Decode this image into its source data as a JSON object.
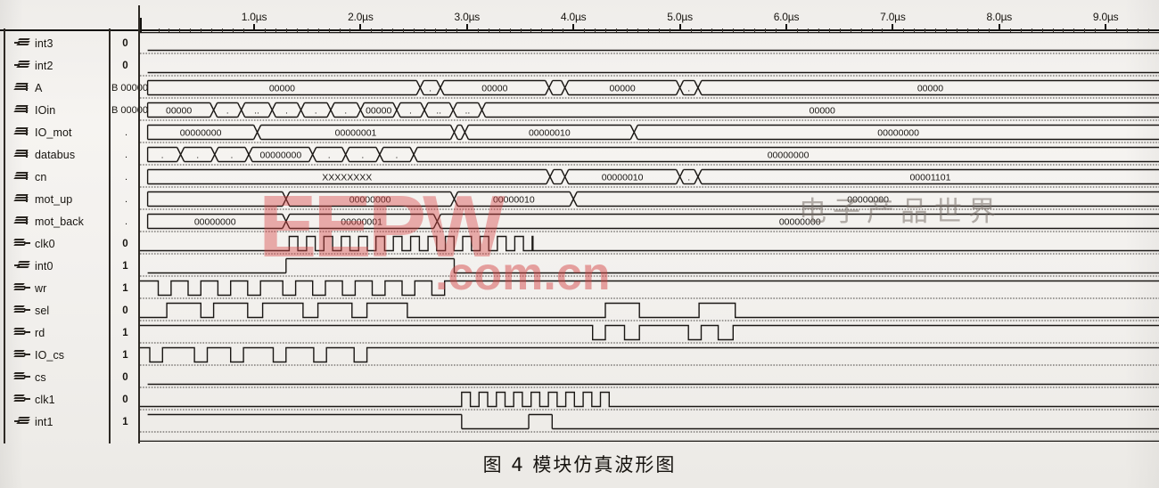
{
  "caption": "图 4  模块仿真波形图",
  "watermark": {
    "brand": "EEPW",
    "domain": ".com.cn",
    "chinese": "电子产品世界",
    "brand_color": "#d64646"
  },
  "ruler": {
    "unit": "µs",
    "ticks": [
      {
        "label": "1.0µs",
        "us": 1.0
      },
      {
        "label": "2.0µs",
        "us": 2.0
      },
      {
        "label": "3.0µs",
        "us": 3.0
      },
      {
        "label": "4.0µs",
        "us": 4.0
      },
      {
        "label": "5.0µs",
        "us": 5.0
      },
      {
        "label": "6.0µs",
        "us": 6.0
      },
      {
        "label": "7.0µs",
        "us": 7.0
      },
      {
        "label": "8.0µs",
        "us": 8.0
      },
      {
        "label": "9.0µs",
        "us": 9.0
      }
    ],
    "range_us": [
      0.0,
      9.58
    ],
    "cursor_us": 0.0
  },
  "signals": [
    {
      "name": "int3",
      "value": "0",
      "icon": "input-signal-icon",
      "kind": "bit"
    },
    {
      "name": "int2",
      "value": "0",
      "icon": "input-signal-icon",
      "kind": "bit"
    },
    {
      "name": "A",
      "value": "B 00000",
      "icon": "bus-signal-icon",
      "kind": "bus"
    },
    {
      "name": "IOin",
      "value": "B 00000",
      "icon": "bus-signal-icon",
      "kind": "bus"
    },
    {
      "name": "IO_mot",
      "value": ".",
      "icon": "bus-signal-icon",
      "kind": "bus"
    },
    {
      "name": "databus",
      "value": ".",
      "icon": "bus-signal-icon",
      "kind": "bus"
    },
    {
      "name": "cn",
      "value": ".",
      "icon": "bus-signal-icon",
      "kind": "bus"
    },
    {
      "name": "mot_up",
      "value": ".",
      "icon": "bus-signal-icon",
      "kind": "bus"
    },
    {
      "name": "mot_back",
      "value": ".",
      "icon": "bus-signal-icon",
      "kind": "bus"
    },
    {
      "name": "clk0",
      "value": "0",
      "icon": "output-signal-icon",
      "kind": "bit"
    },
    {
      "name": "int0",
      "value": "1",
      "icon": "input-signal-icon",
      "kind": "bit"
    },
    {
      "name": "wr",
      "value": "1",
      "icon": "output-signal-icon",
      "kind": "bit"
    },
    {
      "name": "sel",
      "value": "0",
      "icon": "output-signal-icon",
      "kind": "bit"
    },
    {
      "name": "rd",
      "value": "1",
      "icon": "output-signal-icon",
      "kind": "bit"
    },
    {
      "name": "IO_cs",
      "value": "1",
      "icon": "output-signal-icon",
      "kind": "bit"
    },
    {
      "name": "cs",
      "value": "0",
      "icon": "output-signal-icon",
      "kind": "bit"
    },
    {
      "name": "clk1",
      "value": "0",
      "icon": "output-signal-icon",
      "kind": "bit"
    },
    {
      "name": "int1",
      "value": "1",
      "icon": "input-signal-icon",
      "kind": "bit"
    }
  ],
  "chart_data": {
    "type": "timing-diagram",
    "title": "图 4  模块仿真波形图",
    "xlabel": "time",
    "x_unit": "µs",
    "xlim": [
      0.0,
      9.58
    ],
    "grid": false,
    "legend": "none",
    "waveforms": [
      {
        "name": "int3",
        "type": "bit",
        "segments": [
          {
            "from": 0.0,
            "to": 9.58,
            "level": 0
          }
        ]
      },
      {
        "name": "int2",
        "type": "bit",
        "segments": [
          {
            "from": 0.0,
            "to": 9.58,
            "level": 0
          }
        ]
      },
      {
        "name": "A",
        "type": "bus",
        "segments": [
          {
            "from": 0.0,
            "to": 2.56,
            "label": "00000"
          },
          {
            "from": 2.56,
            "to": 2.75,
            "label": "."
          },
          {
            "from": 2.75,
            "to": 3.77,
            "label": "00000"
          },
          {
            "from": 3.77,
            "to": 3.92,
            "label": "."
          },
          {
            "from": 3.92,
            "to": 5.0,
            "label": "00000"
          },
          {
            "from": 5.0,
            "to": 5.17,
            "label": "."
          },
          {
            "from": 5.17,
            "to": 9.58,
            "label": "00000"
          }
        ]
      },
      {
        "name": "IOin",
        "type": "bus",
        "segments": [
          {
            "from": 0.0,
            "to": 0.62,
            "label": "00000"
          },
          {
            "from": 0.62,
            "to": 0.88,
            "label": "."
          },
          {
            "from": 0.88,
            "to": 1.17,
            "label": ".."
          },
          {
            "from": 1.17,
            "to": 1.44,
            "label": "."
          },
          {
            "from": 1.44,
            "to": 1.72,
            "label": "."
          },
          {
            "from": 1.72,
            "to": 2.0,
            "label": "."
          },
          {
            "from": 2.0,
            "to": 2.34,
            "label": "00000"
          },
          {
            "from": 2.34,
            "to": 2.6,
            "label": "."
          },
          {
            "from": 2.6,
            "to": 2.87,
            "label": ".."
          },
          {
            "from": 2.87,
            "to": 3.14,
            "label": ".."
          },
          {
            "from": 3.14,
            "to": 9.58,
            "label": "00000"
          }
        ]
      },
      {
        "name": "IO_mot",
        "type": "bus",
        "segments": [
          {
            "from": 0.0,
            "to": 1.03,
            "label": "00000000"
          },
          {
            "from": 1.03,
            "to": 2.88,
            "label": "00000001"
          },
          {
            "from": 2.88,
            "to": 2.98,
            "label": "."
          },
          {
            "from": 2.98,
            "to": 4.57,
            "label": "00000010"
          },
          {
            "from": 4.57,
            "to": 9.58,
            "label": "00000000"
          }
        ]
      },
      {
        "name": "databus",
        "type": "bus",
        "segments": [
          {
            "from": 0.0,
            "to": 0.31,
            "label": "."
          },
          {
            "from": 0.31,
            "to": 0.63,
            "label": "."
          },
          {
            "from": 0.63,
            "to": 0.95,
            "label": "."
          },
          {
            "from": 0.95,
            "to": 1.55,
            "label": "00000000"
          },
          {
            "from": 1.55,
            "to": 1.86,
            "label": "."
          },
          {
            "from": 1.86,
            "to": 2.18,
            "label": "."
          },
          {
            "from": 2.18,
            "to": 2.5,
            "label": "."
          },
          {
            "from": 2.5,
            "to": 9.58,
            "label": "00000000"
          }
        ]
      },
      {
        "name": "cn",
        "type": "bus",
        "segments": [
          {
            "from": 0.0,
            "to": 3.78,
            "label": "XXXXXXXX"
          },
          {
            "from": 3.78,
            "to": 3.92,
            "label": "."
          },
          {
            "from": 3.92,
            "to": 5.0,
            "label": "00000010"
          },
          {
            "from": 5.0,
            "to": 5.17,
            "label": "."
          },
          {
            "from": 5.17,
            "to": 9.58,
            "label": "00001101"
          }
        ]
      },
      {
        "name": "mot_up",
        "type": "bus",
        "segments": [
          {
            "from": 0.0,
            "to": 1.3,
            "label": ""
          },
          {
            "from": 1.3,
            "to": 2.88,
            "label": "00000000"
          },
          {
            "from": 2.88,
            "to": 4.0,
            "label": "00000010"
          },
          {
            "from": 4.0,
            "to": 9.58,
            "label": "00000000"
          }
        ]
      },
      {
        "name": "mot_back",
        "type": "bus",
        "segments": [
          {
            "from": 0.0,
            "to": 1.3,
            "label": "00000000"
          },
          {
            "from": 1.3,
            "to": 2.72,
            "label": "00000001"
          },
          {
            "from": 2.72,
            "to": 9.58,
            "label": "00000000"
          }
        ]
      },
      {
        "name": "clk0",
        "type": "clock",
        "start_us": 1.33,
        "end_us": 3.62,
        "period_us": 0.163,
        "duty": 0.5,
        "idle_level": 0
      },
      {
        "name": "int0",
        "type": "bit",
        "segments": [
          {
            "from": 0.0,
            "to": 1.3,
            "level": 0
          },
          {
            "from": 1.3,
            "to": 2.88,
            "level": 1
          },
          {
            "from": 2.88,
            "to": 9.58,
            "level": 0
          }
        ]
      },
      {
        "name": "wr",
        "type": "pulse-train",
        "pulses": [
          [
            0.1,
            0.22
          ],
          [
            0.38,
            0.5
          ],
          [
            0.66,
            0.78
          ],
          [
            0.94,
            1.06
          ],
          [
            1.27,
            1.39
          ],
          [
            1.55,
            1.67
          ],
          [
            1.83,
            1.95
          ],
          [
            2.11,
            2.23
          ],
          [
            2.39,
            2.51
          ],
          [
            2.67,
            2.79
          ]
        ],
        "idle_level": 1
      },
      {
        "name": "sel",
        "type": "pulse-train",
        "pulses": [
          [
            0.18,
            0.5
          ],
          [
            0.62,
            0.94
          ],
          [
            1.08,
            1.46
          ],
          [
            1.6,
            1.92
          ],
          [
            2.06,
            2.44
          ],
          [
            4.3,
            4.62
          ],
          [
            5.18,
            5.52
          ]
        ],
        "idle_level": 0,
        "active_level": 1
      },
      {
        "name": "rd",
        "type": "pulse-train",
        "pulses": [
          [
            4.18,
            4.3
          ],
          [
            4.48,
            4.62
          ],
          [
            5.08,
            5.2
          ],
          [
            5.36,
            5.5
          ]
        ],
        "idle_level": 1
      },
      {
        "name": "IO_cs",
        "type": "pulse-train",
        "pulses": [
          [
            0.02,
            0.14
          ],
          [
            0.44,
            0.56
          ],
          [
            0.78,
            0.9
          ],
          [
            1.18,
            1.3
          ],
          [
            1.56,
            1.68
          ],
          [
            1.94,
            2.06
          ]
        ],
        "idle_level": 1
      },
      {
        "name": "cs",
        "type": "bit",
        "segments": [
          {
            "from": 0.0,
            "to": 9.58,
            "level": 0
          }
        ]
      },
      {
        "name": "clk1",
        "type": "clock",
        "start_us": 2.95,
        "end_us": 4.38,
        "period_us": 0.163,
        "duty": 0.5,
        "idle_level": 0
      },
      {
        "name": "int1",
        "type": "bit",
        "segments": [
          {
            "from": 0.0,
            "to": 2.95,
            "level": 1
          },
          {
            "from": 2.95,
            "to": 3.58,
            "level": 0
          },
          {
            "from": 3.58,
            "to": 3.8,
            "level": 1
          },
          {
            "from": 3.8,
            "to": 9.58,
            "level": 0
          }
        ]
      }
    ]
  }
}
